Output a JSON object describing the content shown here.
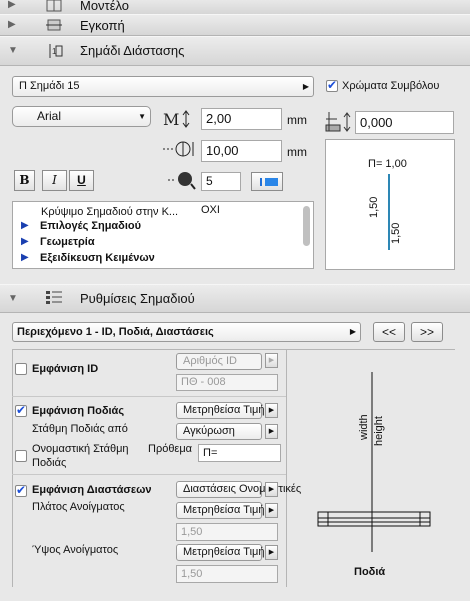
{
  "panels": {
    "model": {
      "title": "Μοντέλο"
    },
    "cut": {
      "title": "Εγκοπή"
    },
    "dimension_marker": {
      "title": "Σημάδι Διάστασης"
    },
    "marker_settings": {
      "title": "Ρυθμίσεις Σημαδιού"
    }
  },
  "marker": {
    "type_selected": "Π Σημάδι 15",
    "symbol_colors_label": "Χρώματα Συμβόλου",
    "symbol_colors_checked": true,
    "font_selected": "Arial",
    "text_height": "2,00",
    "text_height_unit": "mm",
    "offset": "10,00",
    "offset_unit": "mm",
    "pen": "5",
    "right_value": "0,000",
    "style_buttons": {
      "bold": "B",
      "italic": "I",
      "underline": "U"
    },
    "preview": {
      "label_top": "Π= 1,00",
      "label_left": "1,50",
      "label_right": "1,50"
    },
    "tree": [
      {
        "label": "Κρύψιμο Σημαδιού στην Κ...",
        "value": "ΟΧΙ",
        "type": "row"
      },
      {
        "label": "Επιλογές Σημαδιού",
        "type": "group"
      },
      {
        "label": "Γεωμετρία",
        "type": "group"
      },
      {
        "label": "Εξειδίκευση Κειμένων",
        "type": "group"
      }
    ]
  },
  "settings": {
    "content_selected": "Περιεχόμενο 1 - ID, Ποδιά, Διαστάσεις",
    "prev_label": "<<",
    "next_label": ">>",
    "show_id": {
      "label": "Εμφάνιση ID",
      "checked": false,
      "select": "Αριθμός ID",
      "value": "ΠΘ - 008"
    },
    "show_sill": {
      "label": "Εμφάνιση Ποδιάς",
      "checked": true,
      "select": "Μετρηθείσα Τιμή",
      "level_label": "Στάθμη Ποδιάς από",
      "level_select": "Αγκύρωση",
      "nominal_label_line1": "Ονομαστική Στάθμη",
      "nominal_label_line2": "Ποδιάς",
      "nominal_checked": false,
      "prefix_label": "Πρόθεμα",
      "prefix_value": "Π="
    },
    "show_dims": {
      "label": "Εμφάνιση Διαστάσεων",
      "checked": true,
      "select": "Διαστάσεις Ονομαστικές",
      "width_label": "Πλάτος Ανοίγματος",
      "width_select": "Μετρηθείσα Τιμή",
      "width_value": "1,50",
      "height_label": "Ύψος Ανοίγματος",
      "height_select": "Μετρηθείσα Τιμή",
      "height_value": "1,50"
    },
    "diagram": {
      "width_label": "width",
      "height_label": "height",
      "caption": "Ποδιά"
    }
  }
}
